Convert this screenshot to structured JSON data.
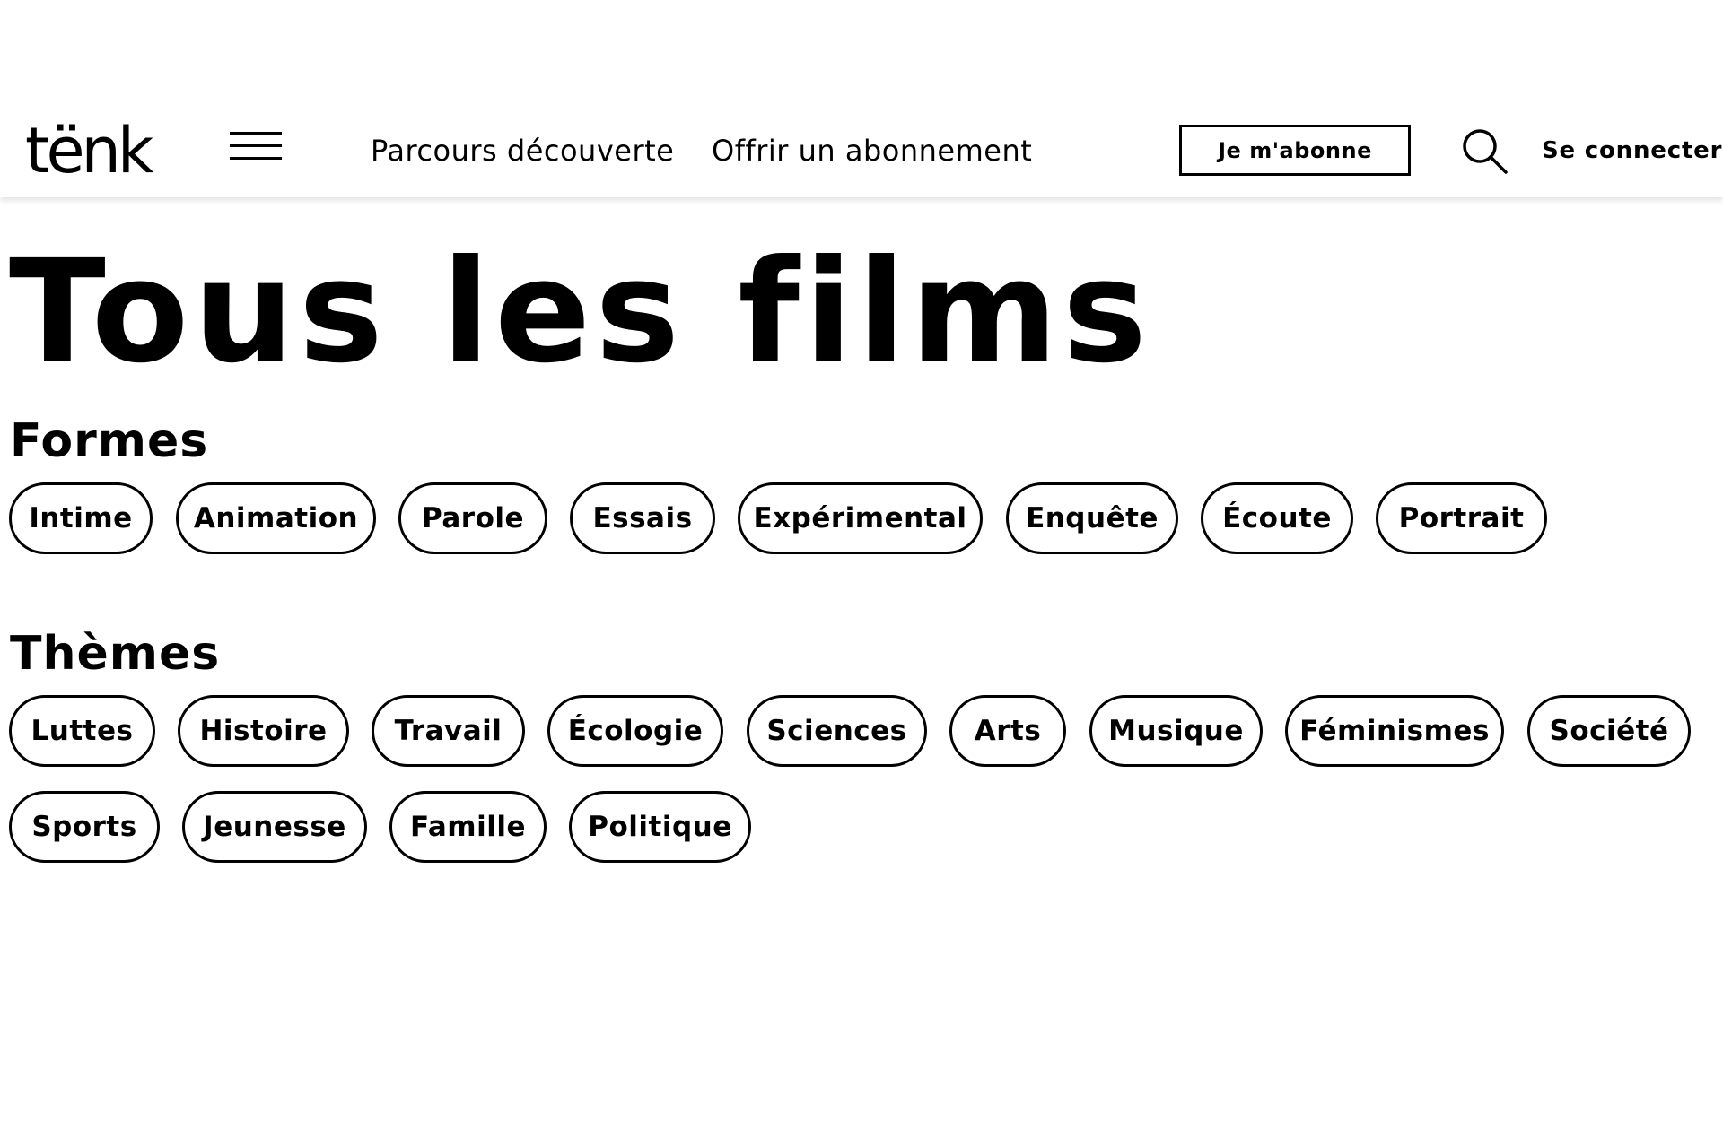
{
  "header": {
    "logo": "tënk",
    "nav": {
      "parcours": "Parcours découverte",
      "offrir": "Offrir un abonnement"
    },
    "subscribe_label": "Je m'abonne",
    "login_label": "Se connecter"
  },
  "main": {
    "title": "Tous les films",
    "formes": {
      "title": "Formes",
      "items": [
        "Intime",
        "Animation",
        "Parole",
        "Essais",
        "Expérimental",
        "Enquête",
        "Écoute",
        "Portrait"
      ]
    },
    "themes": {
      "title": "Thèmes",
      "items": [
        "Luttes",
        "Histoire",
        "Travail",
        "Écologie",
        "Sciences",
        "Arts",
        "Musique",
        "Féminismes",
        "Société",
        "Sports",
        "Jeunesse",
        "Famille",
        "Politique"
      ]
    }
  },
  "icons": {
    "menu": "hamburger-menu-icon",
    "search": "search-icon"
  },
  "colors": {
    "text": "#000000",
    "background": "#ffffff",
    "border": "#000000"
  }
}
